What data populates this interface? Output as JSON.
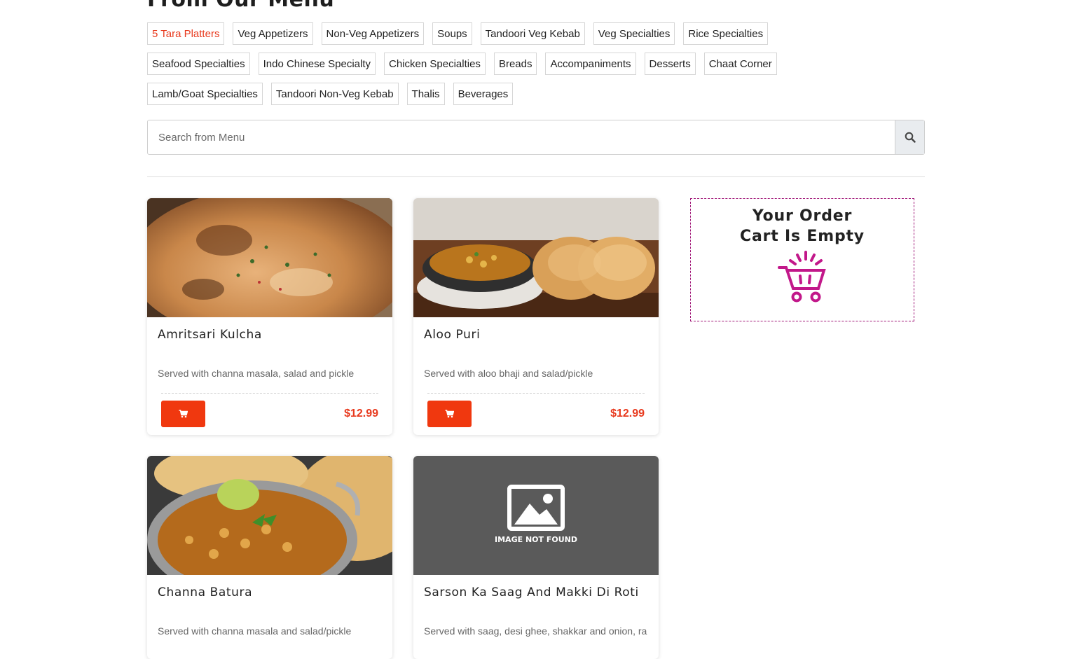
{
  "heading": "From Our Menu",
  "categories": {
    "rows": [
      [
        "5 Tara Platters",
        "Veg Appetizers",
        "Non-Veg Appetizers",
        "Soups",
        "Tandoori Veg Kebab",
        "Veg Specialties",
        "Rice Specialties"
      ],
      [
        "Seafood Specialties",
        "Indo Chinese Specialty",
        "Chicken Specialties",
        "Breads",
        "Accompaniments",
        "Desserts",
        "Chaat Corner"
      ],
      [
        "Lamb/Goat Specialties",
        "Tandoori Non-Veg Kebab",
        "Thalis",
        "Beverages"
      ]
    ],
    "active": "5 Tara Platters"
  },
  "search": {
    "placeholder": "Search from Menu",
    "value": ""
  },
  "items": [
    {
      "title": "Amritsari Kulcha",
      "desc": "Served with channa masala, salad and pickle",
      "price": "$12.99"
    },
    {
      "title": "Aloo Puri",
      "desc": "Served with aloo bhaji and salad/pickle",
      "price": "$12.99"
    },
    {
      "title": "Channa Batura",
      "desc": "Served with channa masala and salad/pickle"
    },
    {
      "title": "Sarson Ka Saag And Makki Di Roti",
      "desc": "Served with saag, desi ghee, shakkar and onion, ra",
      "image_text": "IMAGE NOT FOUND"
    }
  ],
  "order": {
    "line1": "Your Order",
    "line2": "Cart Is Empty"
  },
  "colors": {
    "accent": "#e8391d",
    "cart_button": "#f0380f",
    "order_border": "#a01577",
    "basket_icon": "#c2188a"
  }
}
